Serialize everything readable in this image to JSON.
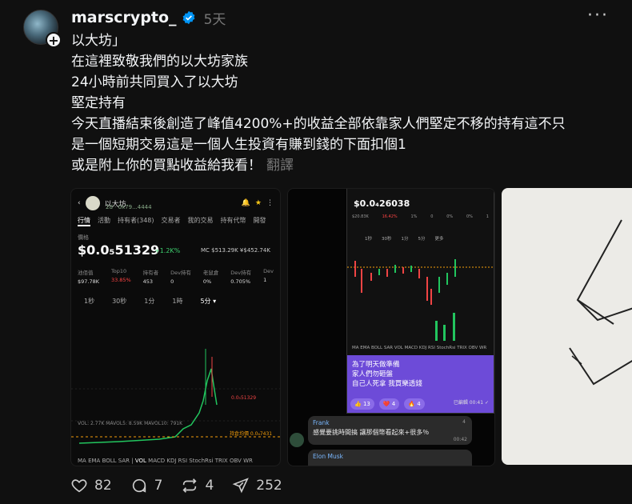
{
  "author": {
    "username": "marscrypto_",
    "time": "5天"
  },
  "post": {
    "lines": [
      "以大坊」",
      "在這裡致敬我們的以大坊家族",
      "24小時前共同買入了以大坊",
      "堅定持有",
      "今天直播結束後創造了峰值4200%+的收益全部依靠家人們堅定不移的持有這不只",
      "是一個短期交易這是一個人生投資有賺到錢的下面扣個1",
      "或是附上你的買點收益給我看！"
    ],
    "translate": "翻譯"
  },
  "media1": {
    "coin_name": "以大坊",
    "coin_sub": "2d · 0x79...4444",
    "tabs": [
      "行情",
      "活動",
      "持有者(348)",
      "交易者",
      "我的交易",
      "持有代幣",
      "開發"
    ],
    "price_label": "價格",
    "price": "$0.0₅51329",
    "change": "+1.2K%",
    "mc": "MC $513.29K  ¥$452.74K",
    "stats": [
      {
        "label": "池佰值",
        "value": "$97.78K"
      },
      {
        "label": "Top10",
        "value": "33.85%"
      },
      {
        "label": "持有者",
        "value": "453"
      },
      {
        "label": "Dev持有",
        "value": "0"
      },
      {
        "label": "老鼠倉",
        "value": "0%"
      },
      {
        "label": "Dev持有",
        "value": "0.705%"
      },
      {
        "label": "Dev",
        "value": "1"
      }
    ],
    "timeframes": [
      "1秒",
      "30秒",
      "1分",
      "1時",
      "5分 ▾"
    ],
    "vol_label": "VOL: 2.77K  MAVOL5: 8.59K  MAVOL10: 791K",
    "indicators": [
      "MA",
      "EMA",
      "BOLL",
      "SAR",
      "VOL",
      "MACD",
      "KDJ",
      "RSI",
      "StochRsi",
      "TRIX",
      "OBV",
      "WR"
    ],
    "price_tag": "0.0₅51329",
    "avg_tag": "持倉均價 0.0₆7431"
  },
  "media2": {
    "price": "$0.0₄26038",
    "stats": [
      "$20.83K",
      "16.42%",
      "1%",
      "0",
      "0%",
      "0%",
      "1"
    ],
    "timeframes": [
      "1秒",
      "30秒",
      "1分",
      "5分",
      "更多"
    ],
    "indicators": "MA EMA BOLL SAR VOL MACD KDJ RSI StochRsi TRIX OBV WR",
    "bubble_lines": [
      "為了明天做準備",
      "家人們勿砸盤",
      "自己人死拿 我買樂透錢"
    ],
    "reactions": [
      "👍 13",
      "❤️ 4",
      "🔥 4"
    ],
    "bubble_time": "已編輯 00:41 ✓",
    "frank_name": "Frank",
    "frank_msg": "感覺要挑時間搞 讓那個幣看起來+很多％",
    "frank_time": "00:42",
    "frank_count": "4",
    "elon_name": "Elon Musk"
  },
  "actions": {
    "likes": "82",
    "comments": "7",
    "reposts": "4",
    "shares": "252"
  },
  "colors": {
    "background": "#101010",
    "verified": "#0095f6",
    "chart_green": "#22c55e",
    "chart_red": "#ef4444",
    "bubble": "#6d4bd8"
  }
}
